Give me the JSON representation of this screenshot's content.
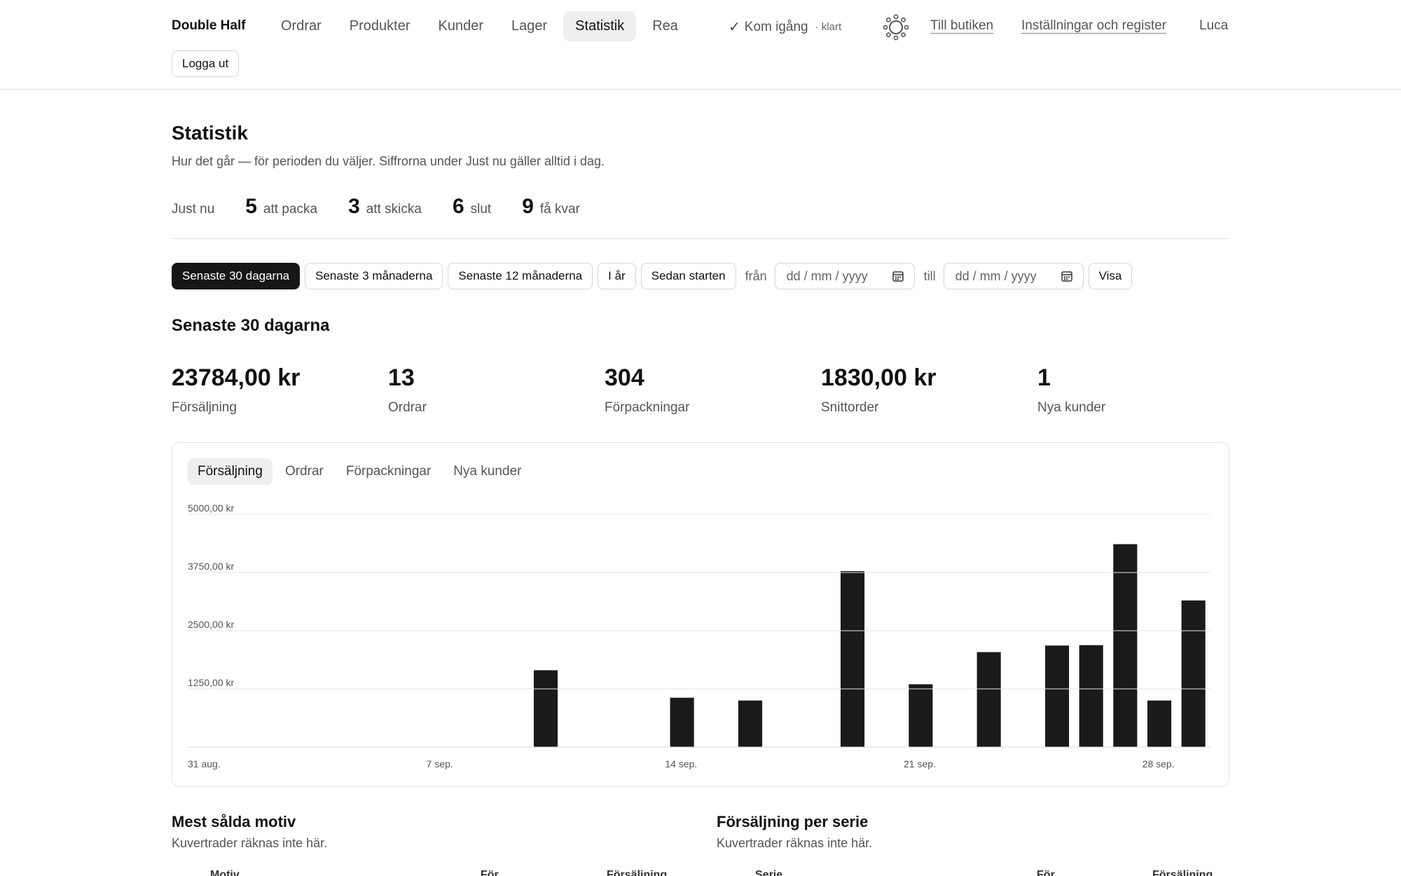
{
  "header": {
    "brand": "Double Half",
    "nav": [
      "Ordrar",
      "Produkter",
      "Kunder",
      "Lager",
      "Statistik",
      "Rea"
    ],
    "active_nav": "Statistik",
    "getting_started": {
      "label": "Kom igång",
      "status": "· klart"
    },
    "theme_icon": "sun-icon",
    "links": {
      "shop": "Till butiken",
      "settings": "Inställningar och register"
    },
    "user": "Luca",
    "logout": "Logga ut"
  },
  "page": {
    "title": "Statistik",
    "subtitle": "Hur det går — för perioden du väljer. Siffrorna under Just nu gäller alltid i dag."
  },
  "justnu": {
    "label": "Just nu",
    "metrics": [
      {
        "value": "5",
        "label": "att packa"
      },
      {
        "value": "3",
        "label": "att skicka"
      },
      {
        "value": "6",
        "label": "slut"
      },
      {
        "value": "9",
        "label": "få kvar"
      }
    ]
  },
  "filters": {
    "ranges": [
      "Senaste 30 dagarna",
      "Senaste 3 månaderna",
      "Senaste 12 månaderna",
      "I år",
      "Sedan starten"
    ],
    "active_range": "Senaste 30 dagarna",
    "from_label": "från",
    "to_label": "till",
    "date_placeholder": "dd / mm / yyyy",
    "show_button": "Visa"
  },
  "section_title": "Senaste 30 dagarna",
  "kpis": [
    {
      "value": "23784,00 kr",
      "label": "Försäljning"
    },
    {
      "value": "13",
      "label": "Ordrar"
    },
    {
      "value": "304",
      "label": "Förpackningar"
    },
    {
      "value": "1830,00 kr",
      "label": "Snittorder"
    },
    {
      "value": "1",
      "label": "Nya kunder"
    }
  ],
  "chart_tabs": [
    "Försäljning",
    "Ordrar",
    "Förpackningar",
    "Nya kunder"
  ],
  "active_chart_tab": "Försäljning",
  "chart_data": {
    "type": "bar",
    "ylim": [
      0,
      5000
    ],
    "yticks": [
      {
        "value": 1250,
        "label": "1250,00 kr"
      },
      {
        "value": 2500,
        "label": "2500,00 kr"
      },
      {
        "value": 3750,
        "label": "3750,00 kr"
      },
      {
        "value": 5000,
        "label": "5000,00 kr"
      }
    ],
    "xtick_labels": [
      {
        "index": 0,
        "label": "31 aug."
      },
      {
        "index": 7,
        "label": "7 sep."
      },
      {
        "index": 14,
        "label": "14 sep."
      },
      {
        "index": 21,
        "label": "21 sep."
      },
      {
        "index": 28,
        "label": "28 sep."
      }
    ],
    "categories": [
      "31 aug.",
      "1 sep.",
      "2 sep.",
      "3 sep.",
      "4 sep.",
      "5 sep.",
      "6 sep.",
      "7 sep.",
      "8 sep.",
      "9 sep.",
      "10 sep.",
      "11 sep.",
      "12 sep.",
      "13 sep.",
      "14 sep.",
      "15 sep.",
      "16 sep.",
      "17 sep.",
      "18 sep.",
      "19 sep.",
      "20 sep.",
      "21 sep.",
      "22 sep.",
      "23 sep.",
      "24 sep.",
      "25 sep.",
      "26 sep.",
      "27 sep.",
      "28 sep.",
      "29 sep."
    ],
    "values": [
      0,
      0,
      0,
      0,
      0,
      0,
      0,
      0,
      0,
      0,
      1650,
      0,
      0,
      0,
      1060,
      0,
      1000,
      0,
      0,
      3780,
      0,
      1350,
      0,
      2040,
      0,
      2180,
      2190,
      4360,
      1000,
      3150
    ],
    "grid": true
  },
  "bottom": {
    "left": {
      "title": "Mest sålda motiv",
      "subtitle": "Kuvertrader räknas inte här.",
      "columns": [
        "Motiv",
        "För",
        "Försäljning"
      ]
    },
    "right": {
      "title": "Försäljning per serie",
      "subtitle": "Kuvertrader räknas inte här.",
      "columns": [
        "Serie",
        "För",
        "Försäljning"
      ]
    }
  }
}
